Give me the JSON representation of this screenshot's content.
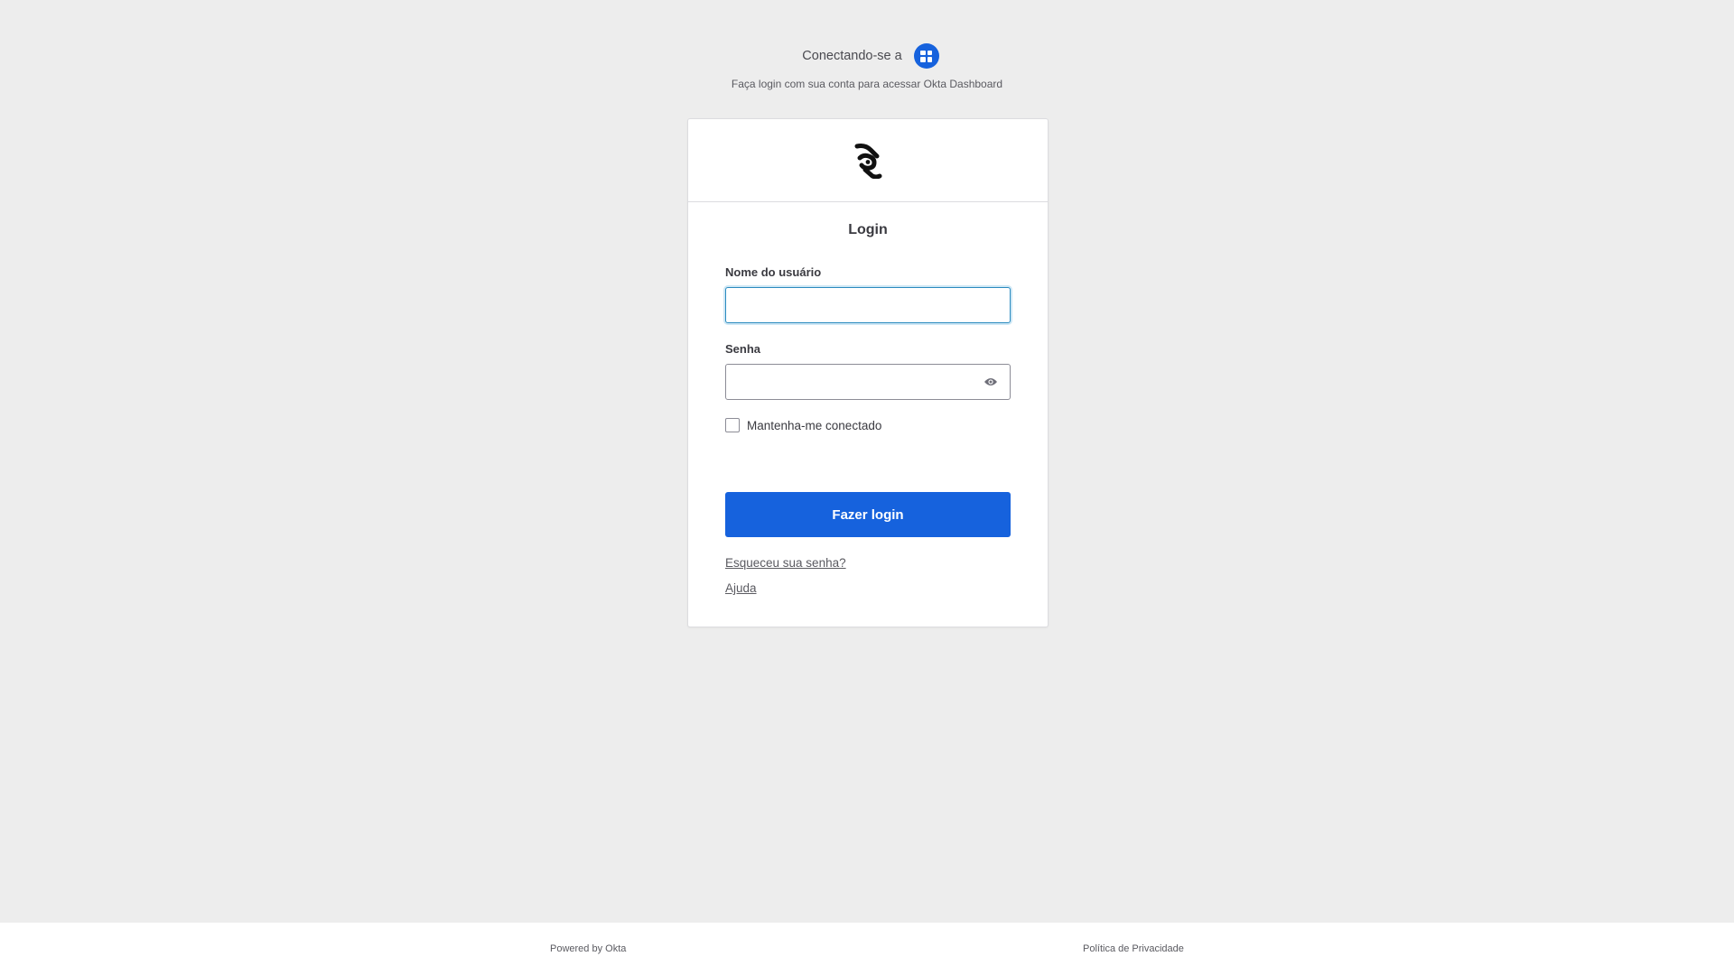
{
  "header": {
    "connecting_text": "Conectando-se a",
    "app_icon": "app-grid-icon",
    "subtitle": "Faça login com sua conta para acessar Okta Dashboard"
  },
  "card": {
    "logo_icon": "org-logo",
    "title": "Login",
    "username": {
      "label": "Nome do usuário",
      "value": "",
      "placeholder": ""
    },
    "password": {
      "label": "Senha",
      "value": "",
      "placeholder": "",
      "toggle_icon": "eye-icon"
    },
    "remember_me": {
      "label": "Mantenha-me conectado",
      "checked": false
    },
    "submit_label": "Fazer login",
    "links": {
      "forgot_password": "Esqueceu sua senha?",
      "help": "Ajuda"
    }
  },
  "footer": {
    "powered_by": "Powered by Okta",
    "privacy": "Política de Privacidade"
  },
  "colors": {
    "background": "#ededed",
    "primary": "#1662dd",
    "focus_border": "#2b8bbf"
  }
}
